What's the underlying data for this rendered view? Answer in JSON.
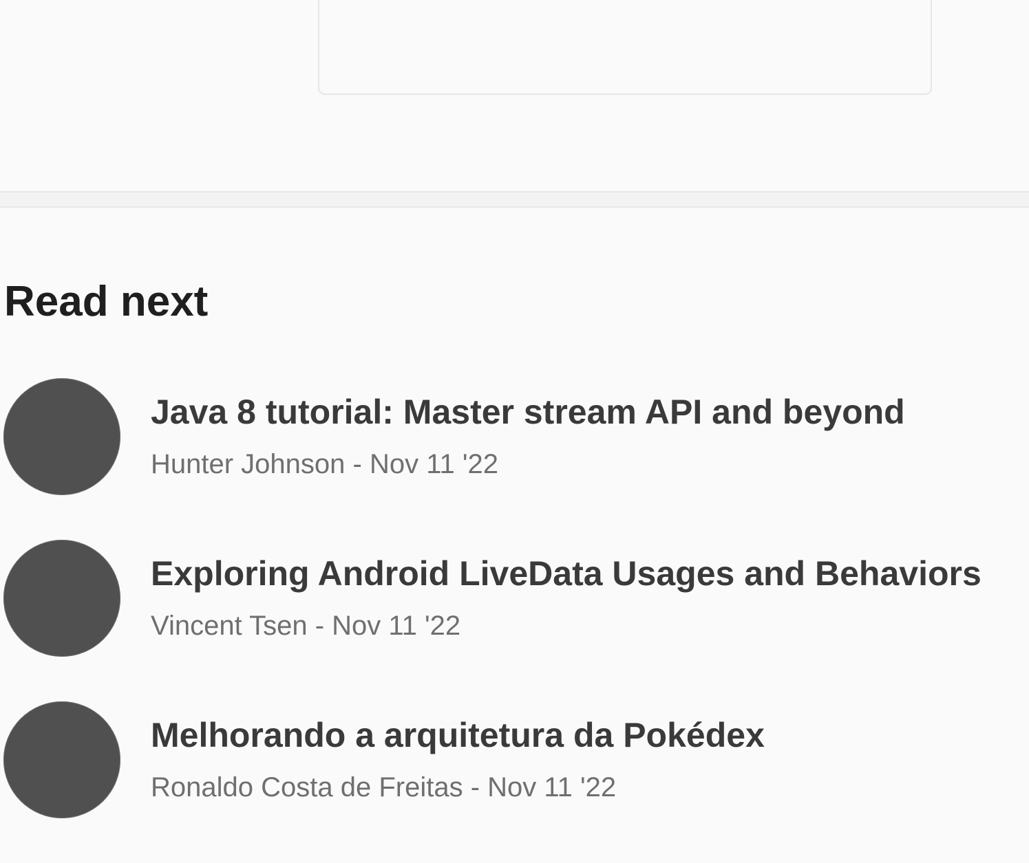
{
  "read_next": {
    "heading": "Read next",
    "articles": [
      {
        "title": "Java 8 tutorial: Master stream API and beyond",
        "author": "Hunter Johnson",
        "date": "Nov 11 '22"
      },
      {
        "title": "Exploring Android LiveData Usages and Behaviors",
        "author": "Vincent Tsen",
        "date": "Nov 11 '22"
      },
      {
        "title": "Melhorando a arquitetura da Pokédex",
        "author": "Ronaldo Costa de Freitas",
        "date": "Nov 11 '22"
      }
    ]
  },
  "colors": {
    "background": "#fafafa",
    "avatar": "#505050",
    "title": "#3a3a3a",
    "meta": "#6f6f6f",
    "heading": "#1f1f1f"
  }
}
